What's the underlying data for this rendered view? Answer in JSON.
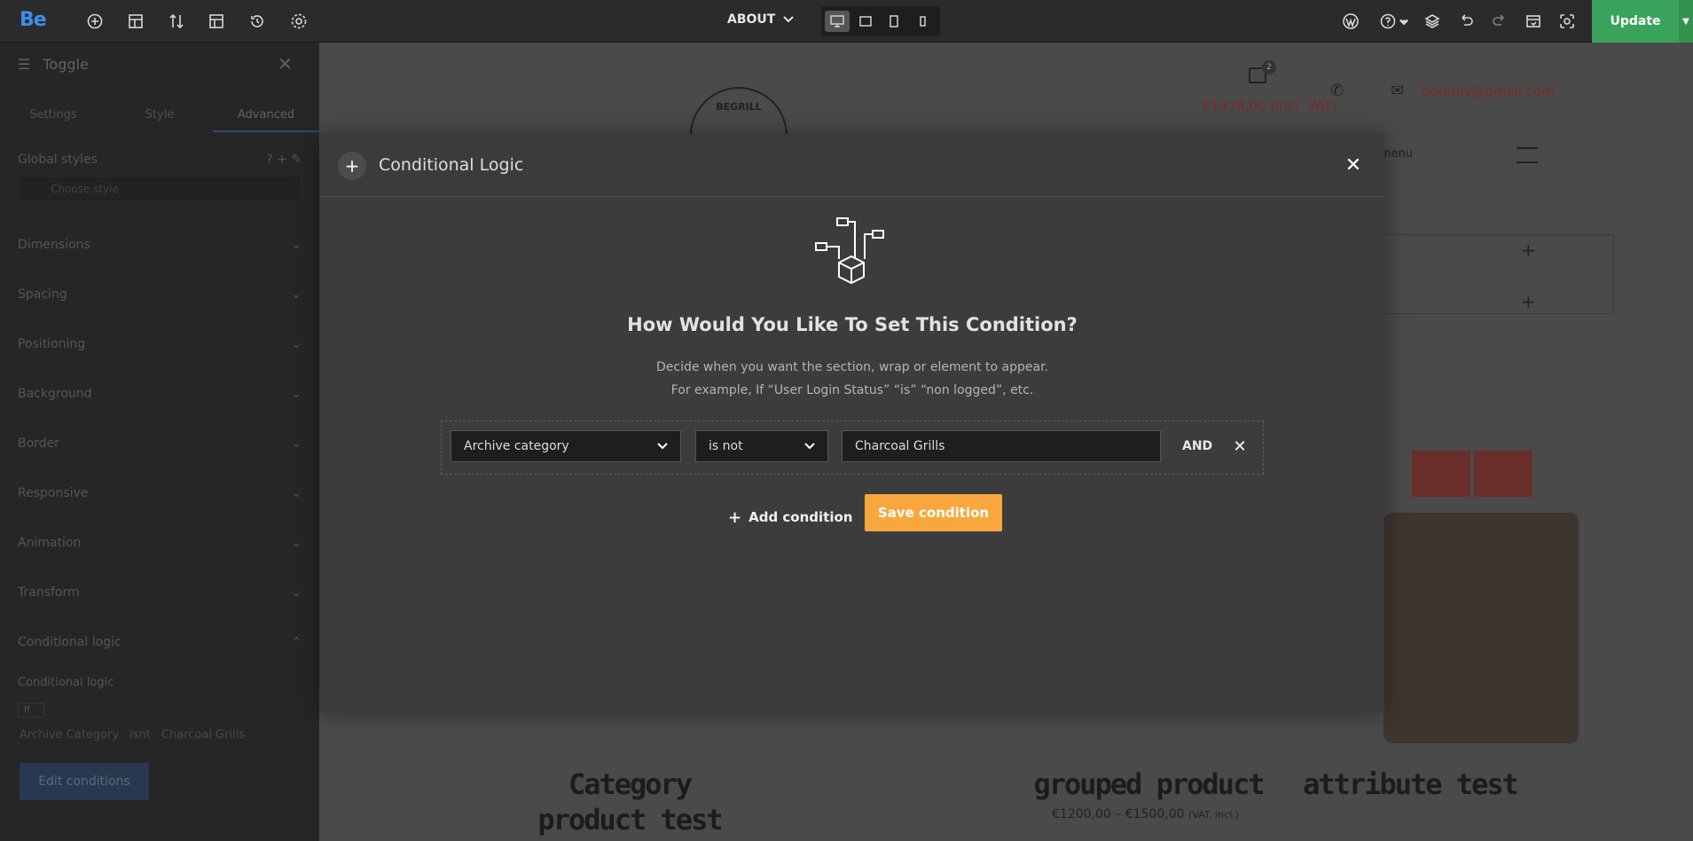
{
  "topbar": {
    "logo": "Be",
    "page_select": "ABOUT",
    "update_label": "Update"
  },
  "sidebar": {
    "title": "Toggle",
    "tabs": [
      "Settings",
      "Style",
      "Advanced"
    ],
    "global_styles_label": "Global styles",
    "choose_style_placeholder": "Choose style",
    "sections": [
      "Dimensions",
      "Spacing",
      "Positioning",
      "Background",
      "Border",
      "Responsive",
      "Animation",
      "Transform",
      "Conditional logic"
    ],
    "conditional_logic_label": "Conditional logic",
    "if_label": "If",
    "chips": [
      "Archive Category",
      "isnt",
      "Charcoal Grills"
    ],
    "edit_conditions_label": "Edit conditions"
  },
  "canvas": {
    "logo_text": "BEGRILL",
    "cart_count": "2",
    "price": "€1478,00 (incl. VAT)",
    "email": "noreply@gmail.com",
    "menu_label": "menu",
    "products": [
      {
        "title": "Category product test"
      },
      {
        "title": "grouped product",
        "price": "€1200,00 – €1500,00",
        "price_suffix": "(VAT. incl.)"
      },
      {
        "title": "attribute test"
      }
    ]
  },
  "modal": {
    "title": "Conditional Logic",
    "heading": "How Would You Like To Set This Condition?",
    "desc_line1": "Decide when you want the section, wrap or element to appear.",
    "desc_line2": "For example, If “User Login Status” “is” “non logged”, etc.",
    "condition": {
      "field": "Archive category",
      "operator": "is not",
      "value": "Charcoal Grills",
      "joiner": "AND"
    },
    "add_condition_label": "Add condition",
    "save_condition_label": "Save condition"
  },
  "colors": {
    "update": "#3aa35b",
    "save": "#f7a73e",
    "brand": "#3b8fe8"
  }
}
